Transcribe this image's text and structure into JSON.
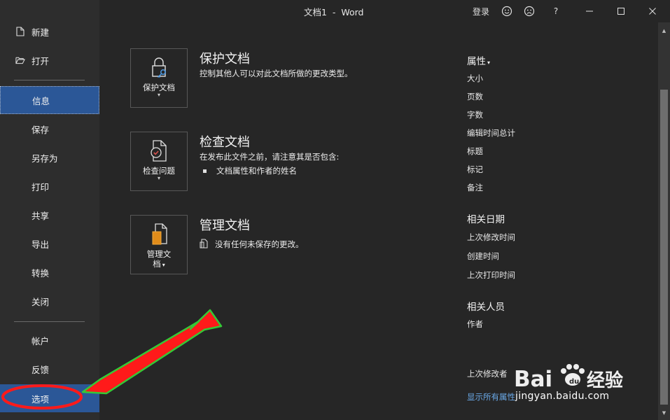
{
  "window": {
    "title": "文档1  -  Word",
    "signin": "登录",
    "help": "?",
    "minimize": "—",
    "maximize": "☐",
    "close": "✕"
  },
  "sidebar": {
    "new": "新建",
    "open": "打开",
    "info": "信息",
    "save": "保存",
    "save_as": "另存为",
    "print": "打印",
    "share": "共享",
    "export": "导出",
    "transform": "转换",
    "close": "关闭",
    "account": "帐户",
    "feedback": "反馈",
    "options": "选项"
  },
  "protect": {
    "card_label": "保护文档",
    "title": "保护文档",
    "desc": "控制其他人可以对此文档所做的更改类型。"
  },
  "inspect": {
    "card_label": "检查问题",
    "title": "检查文档",
    "desc": "在发布此文件之前，请注意其是否包含:",
    "bullet": "文档属性和作者的姓名"
  },
  "manage": {
    "card_label_line1": "管理文",
    "card_label_line2": "档",
    "title": "管理文档",
    "desc": "没有任何未保存的更改。"
  },
  "properties": {
    "heading": "属性",
    "items": [
      "大小",
      "页数",
      "字数",
      "编辑时间总计",
      "标题",
      "标记",
      "备注"
    ],
    "dates_heading": "相关日期",
    "dates": [
      "上次修改时间",
      "创建时间",
      "上次打印时间"
    ],
    "people_heading": "相关人员",
    "author": "作者",
    "last_modified_by": "上次修改者",
    "show_all": "显示所有属性"
  },
  "watermark": {
    "brand": "Bai 经验",
    "url": "jingyan.baidu.com"
  },
  "colors": {
    "background": "#262626",
    "sidebar": "#2d2d2d",
    "selected": "#2b5797",
    "link": "#6aa9e8",
    "annotation_red": "#ff1a1a",
    "annotation_green": "#35c936"
  }
}
